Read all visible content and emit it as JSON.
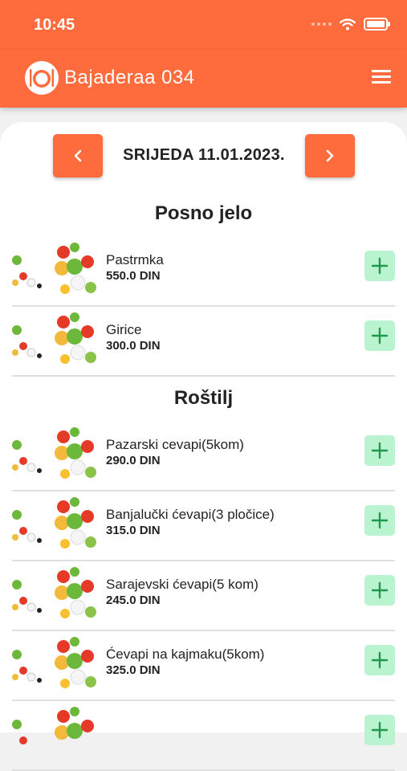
{
  "status_bar": {
    "time": "10:45"
  },
  "app_bar": {
    "title": "Bajaderaa 034"
  },
  "date_nav": {
    "date": "SRIJEDA 11.01.2023."
  },
  "sections": [
    {
      "title": "Posno jelo",
      "items": [
        {
          "name": "Pastrmka",
          "price": "550.0 DIN"
        },
        {
          "name": "Girice",
          "price": "300.0 DIN"
        }
      ]
    },
    {
      "title": "Roštilj",
      "items": [
        {
          "name": "Pazarski cevapi(5kom)",
          "price": "290.0 DIN"
        },
        {
          "name": "Banjalučki ćevapi(3 pločice)",
          "price": "315.0 DIN"
        },
        {
          "name": "Sarajevski ćevapi(5 kom)",
          "price": "245.0 DIN"
        },
        {
          "name": "Ćevapi na kajmaku(5kom)",
          "price": "325.0 DIN"
        }
      ]
    }
  ],
  "colors": {
    "primary": "#fe6b3c",
    "add_button": "#b9f3cf",
    "add_icon": "#1e9a4b"
  },
  "icons": {
    "menu": "hamburger-icon",
    "prev": "chevron-left-icon",
    "next": "chevron-right-icon",
    "add": "plus-icon",
    "logo": "plate-cutlery-icon"
  }
}
